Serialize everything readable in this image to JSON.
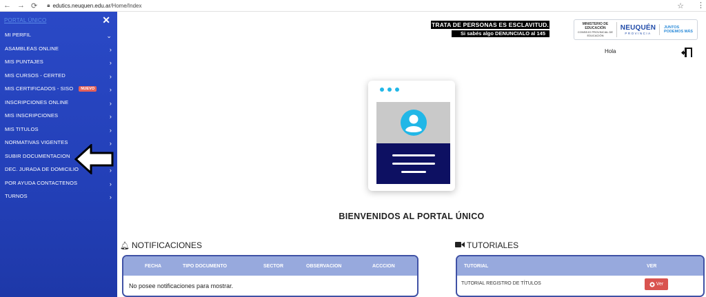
{
  "browser": {
    "url_host": "edutics.neuquen.edu.ar",
    "url_path": "/Home/Index"
  },
  "sidebar": {
    "title": "PORTAL ÚNICO",
    "items": [
      {
        "label": "MI PERFIL"
      },
      {
        "label": "ASAMBLEAS ONLINE"
      },
      {
        "label": "MIS PUNTAJES"
      },
      {
        "label": "MIS CURSOS - CERTED"
      },
      {
        "label": "MIS CERTIFICADOS - SISO",
        "badge": "NUEVO"
      },
      {
        "label": "INSCRIPCIONES ONLINE"
      },
      {
        "label": "MIS INSCRIPCIONES"
      },
      {
        "label": "MIS TITULOS"
      },
      {
        "label": "NORMATIVAS VIGENTES"
      },
      {
        "label": "SUBIR DOCUMENTACION"
      },
      {
        "label": "DEC. JURADA DE DOMICILIO"
      },
      {
        "label": "POR AYUDA CONTACTENOS"
      },
      {
        "label": "TURNOS"
      }
    ]
  },
  "banner": {
    "line1": "TRATA DE PERSONAS ES ESCLAVITUD.",
    "line2": "Si sabés algo DENUNCIALO al 145"
  },
  "gov_logo": {
    "ministerio": "MINISTERIO DE EDUCACIÓN",
    "consejo": "CONSEJO PROVINCIAL DE EDUCACIÓN",
    "neuquen": "NEUQUÉN",
    "provincia": "PROVINCIA",
    "slogan": "JUNTOS PODEMOS MÁS"
  },
  "header": {
    "greeting": "Hola"
  },
  "main": {
    "welcome": "BIENVENIDOS AL PORTAL ÚNICO"
  },
  "notifications": {
    "title": "NOTIFICACIONES",
    "columns": [
      "FECHA",
      "TIPO DOCUMENTO",
      "SECTOR",
      "OBSERVACION",
      "ACCCION"
    ],
    "empty_message": "No posee notificaciones para mostrar."
  },
  "tutorials": {
    "title": "TUTORIALES",
    "columns": [
      "TUTORIAL",
      "VER"
    ],
    "rows": [
      {
        "name": "TUTORIAL REGISTRO DE TÍTULOS",
        "button": "Ver"
      }
    ]
  },
  "colors": {
    "sidebar": "#2340b8",
    "table_header": "#97a9dd",
    "table_border": "#3f51a5",
    "card_panel": "#0d1062",
    "accent_cyan": "#21b7e7",
    "badge": "#e4615a",
    "button_danger": "#d9534f"
  }
}
